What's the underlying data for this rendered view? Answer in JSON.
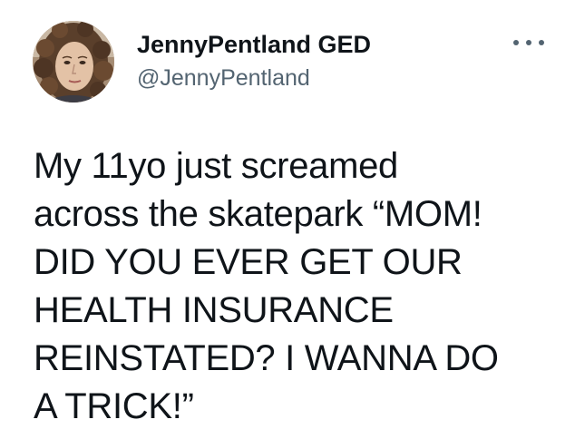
{
  "tweet": {
    "author": {
      "display_name": "JennyPentland GED",
      "handle": "@JennyPentland",
      "avatar_icon": "profile-photo"
    },
    "more_icon": "more-horizontal-icon",
    "text": "My 11yo just screamed\nacross the skatepark “MOM!\nDID YOU EVER GET OUR\nHEALTH INSURANCE\nREINSTATED? I WANNA DO\nA TRICK!”"
  },
  "colors": {
    "background": "#ffffff",
    "text": "#0f1419",
    "secondary_text": "#536471"
  }
}
